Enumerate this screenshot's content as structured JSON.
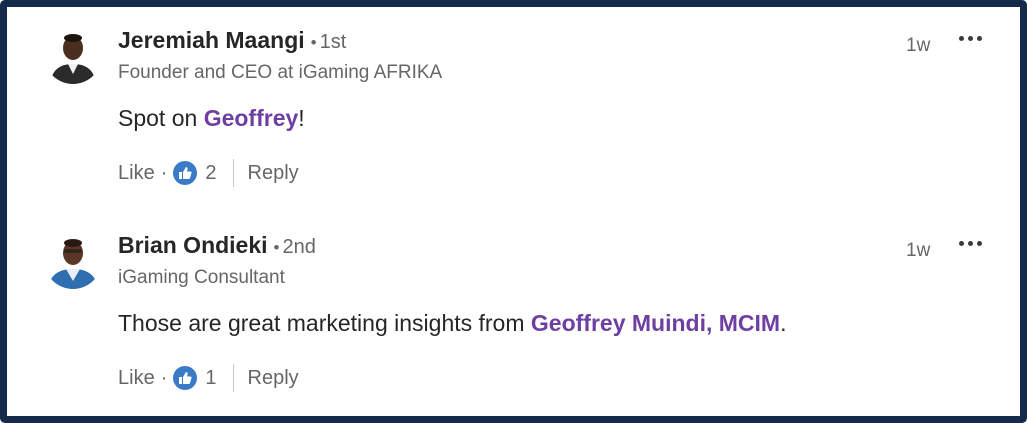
{
  "comments": [
    {
      "author": "Jeremiah Maangi",
      "degree_dot": "•",
      "degree": "1st",
      "headline": "Founder and CEO at iGaming AFRIKA",
      "time": "1w",
      "text_before": "Spot on ",
      "mention": "Geoffrey",
      "text_after": "!",
      "like_label": "Like",
      "sep": "·",
      "reaction_count": "2",
      "reply_label": "Reply",
      "avatar_color": "#2b2b2b",
      "more_icon": "ellipsis-icon",
      "reaction_icon": "thumbs-up-icon"
    },
    {
      "author": "Brian Ondieki",
      "degree_dot": "•",
      "degree": "2nd",
      "headline": "iGaming Consultant",
      "time": "1w",
      "text_before": "Those are great marketing insights from ",
      "mention": "Geoffrey Muindi, MCIM",
      "text_after": ".",
      "like_label": "Like",
      "sep": "·",
      "reaction_count": "1",
      "reply_label": "Reply",
      "avatar_color": "#2f6fb0",
      "more_icon": "ellipsis-icon",
      "reaction_icon": "thumbs-up-icon"
    }
  ],
  "colors": {
    "frame_border": "#15294a",
    "mention": "#6e3fa3",
    "like_icon": "#3a7bc8"
  }
}
